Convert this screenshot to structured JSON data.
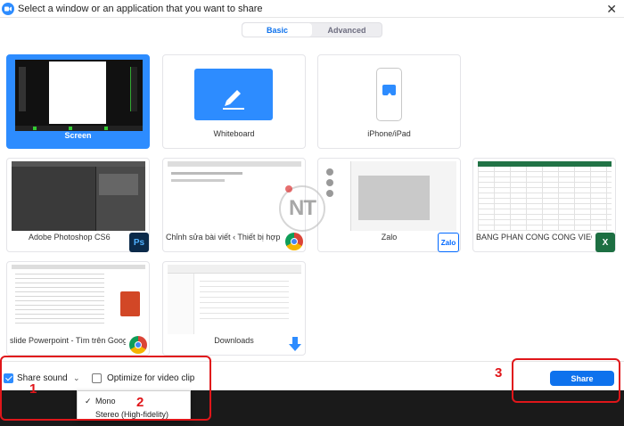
{
  "window": {
    "title": "Select a window or an application that you want to share"
  },
  "tabs": [
    {
      "label": "Basic"
    },
    {
      "label": "Advanced"
    }
  ],
  "tiles": [
    {
      "label": "Screen"
    },
    {
      "label": "Whiteboard"
    },
    {
      "label": "iPhone/iPad"
    },
    {
      "label": "Adobe Photoshop CS6"
    },
    {
      "label": "Chỉnh sửa bài viết ‹ Thiết bị hợp t..."
    },
    {
      "label": "Zalo"
    },
    {
      "label": "BANG PHAN CONG CONG VIEC ..."
    },
    {
      "label": "slide Powerpoint - Tìm trên Goog..."
    },
    {
      "label": "Downloads"
    }
  ],
  "badges": {
    "photoshop": "Ps",
    "zalo": "Zalo",
    "excel": "X"
  },
  "options": {
    "share_sound": "Share sound",
    "optimize": "Optimize for video clip",
    "share_button": "Share"
  },
  "sound_menu": [
    {
      "label": "Mono"
    },
    {
      "label": "Stereo (High-fidelity)"
    }
  ],
  "annotations": [
    "1",
    "2",
    "3"
  ],
  "watermark": "NT",
  "colors": {
    "accent": "#2d8cff",
    "share_button": "#0e72ed",
    "annotation": "#e0161a"
  }
}
